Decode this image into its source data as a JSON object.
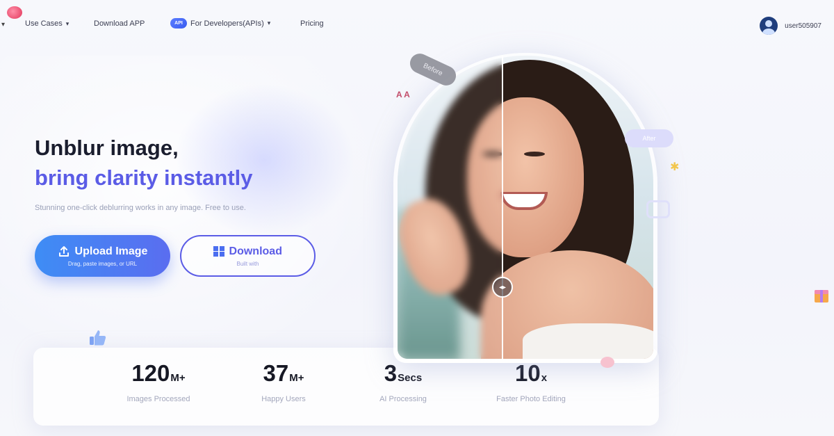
{
  "nav": {
    "items": [
      {
        "label": "Use Cases",
        "has_dropdown": true
      },
      {
        "label": "Download APP",
        "has_dropdown": false
      },
      {
        "label": "For Developers(APIs)",
        "has_dropdown": true,
        "icon": "cloud-icon",
        "icon_text": "API"
      },
      {
        "label": "Pricing",
        "has_dropdown": false
      }
    ],
    "user": {
      "name": "user505907"
    }
  },
  "hero": {
    "title_line1": "Unblur image,",
    "title_line2": "bring clarity instantly",
    "subtitle": "Stunning one-click deblurring works in any image. Free to use.",
    "upload_button": {
      "label": "Upload Image",
      "sub": "Drag, paste images, or URL"
    },
    "download_button": {
      "label": "Download",
      "sub": "Built with"
    }
  },
  "preview": {
    "before_label": "Before",
    "after_label": "After",
    "handle_glyph": "◂▸"
  },
  "stats": [
    {
      "value": "120",
      "suffix": "M+",
      "label": "Images Processed"
    },
    {
      "value": "37",
      "suffix": "M+",
      "label": "Happy Users"
    },
    {
      "value": "3",
      "suffix": "Secs",
      "label": "AI Processing"
    },
    {
      "value": "10",
      "suffix": "x",
      "label": "Faster Photo Editing"
    }
  ],
  "colors": {
    "accent": "#5b5ce6",
    "button_gradient_start": "#3e8df5",
    "button_gradient_end": "#5a6df0"
  }
}
